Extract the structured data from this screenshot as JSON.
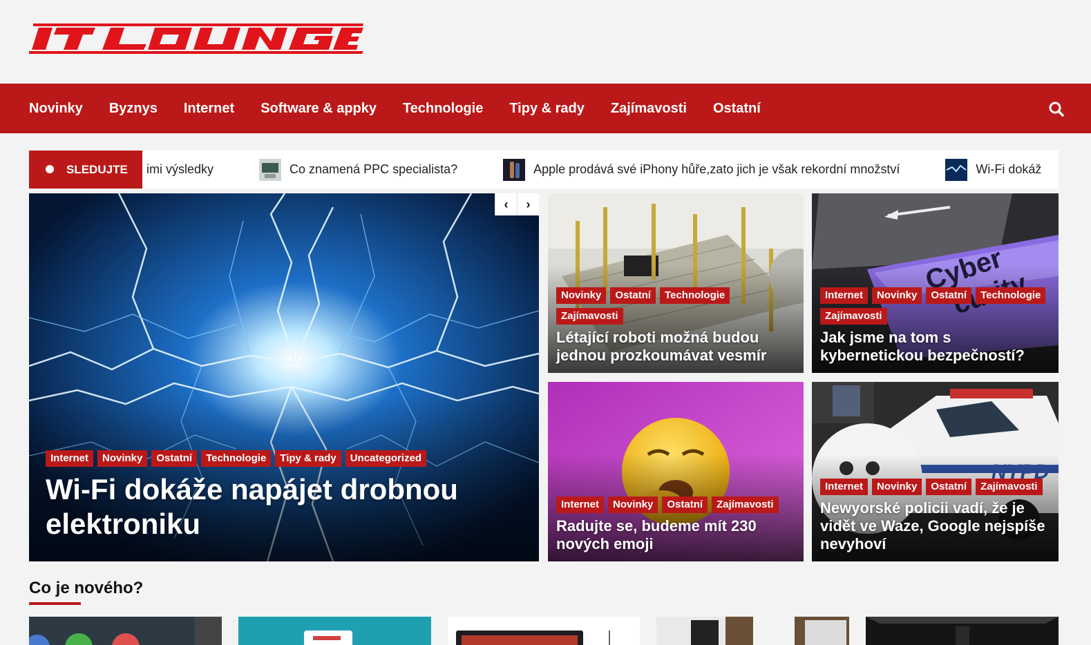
{
  "site": {
    "name": "IT LOUNGE",
    "brand_color": "#bb1919"
  },
  "nav": {
    "items": [
      {
        "label": "Novinky"
      },
      {
        "label": "Byznys"
      },
      {
        "label": "Internet"
      },
      {
        "label": "Software & appky"
      },
      {
        "label": "Technologie"
      },
      {
        "label": "Tipy & rady"
      },
      {
        "label": "Zajímavosti"
      },
      {
        "label": "Ostatní"
      }
    ],
    "search_icon": "search-icon"
  },
  "ticker": {
    "label": "SLEDUJTE",
    "items": [
      {
        "text": "imi výsledky"
      },
      {
        "text": "Co znamená PPC specialista?"
      },
      {
        "text": "Apple prodává své iPhony hůře,zato jich je však rekordní množství"
      },
      {
        "text": "Wi-Fi dokáž"
      }
    ]
  },
  "featured": {
    "categories": [
      "Internet",
      "Novinky",
      "Ostatní",
      "Technologie",
      "Tipy & rady",
      "Uncategorized"
    ],
    "title": "Wi-Fi dokáže napájet drobnou elektroniku",
    "prev_icon": "chevron-left-icon",
    "next_icon": "chevron-right-icon"
  },
  "cards": [
    {
      "categories": [
        "Novinky",
        "Ostatní",
        "Technologie",
        "Zajímavosti"
      ],
      "title": "Létající roboti možná budou jednou prozkoumávat vesmír"
    },
    {
      "categories": [
        "Internet",
        "Novinky",
        "Ostatní",
        "Technologie",
        "Zajímavosti"
      ],
      "title": "Jak jsme na tom s kybernetickou bezpečností?"
    },
    {
      "categories": [
        "Internet",
        "Novinky",
        "Ostatní",
        "Zajímavosti"
      ],
      "title": "Radujte se, budeme mít 230 nových emoji"
    },
    {
      "categories": [
        "Internet",
        "Novinky",
        "Ostatní",
        "Zajímavosti"
      ],
      "title": "Newyorské policii vadí, že je vidět ve Waze, Google nejspíše nevyhoví"
    }
  ],
  "section": {
    "title": "Co je nového?"
  }
}
